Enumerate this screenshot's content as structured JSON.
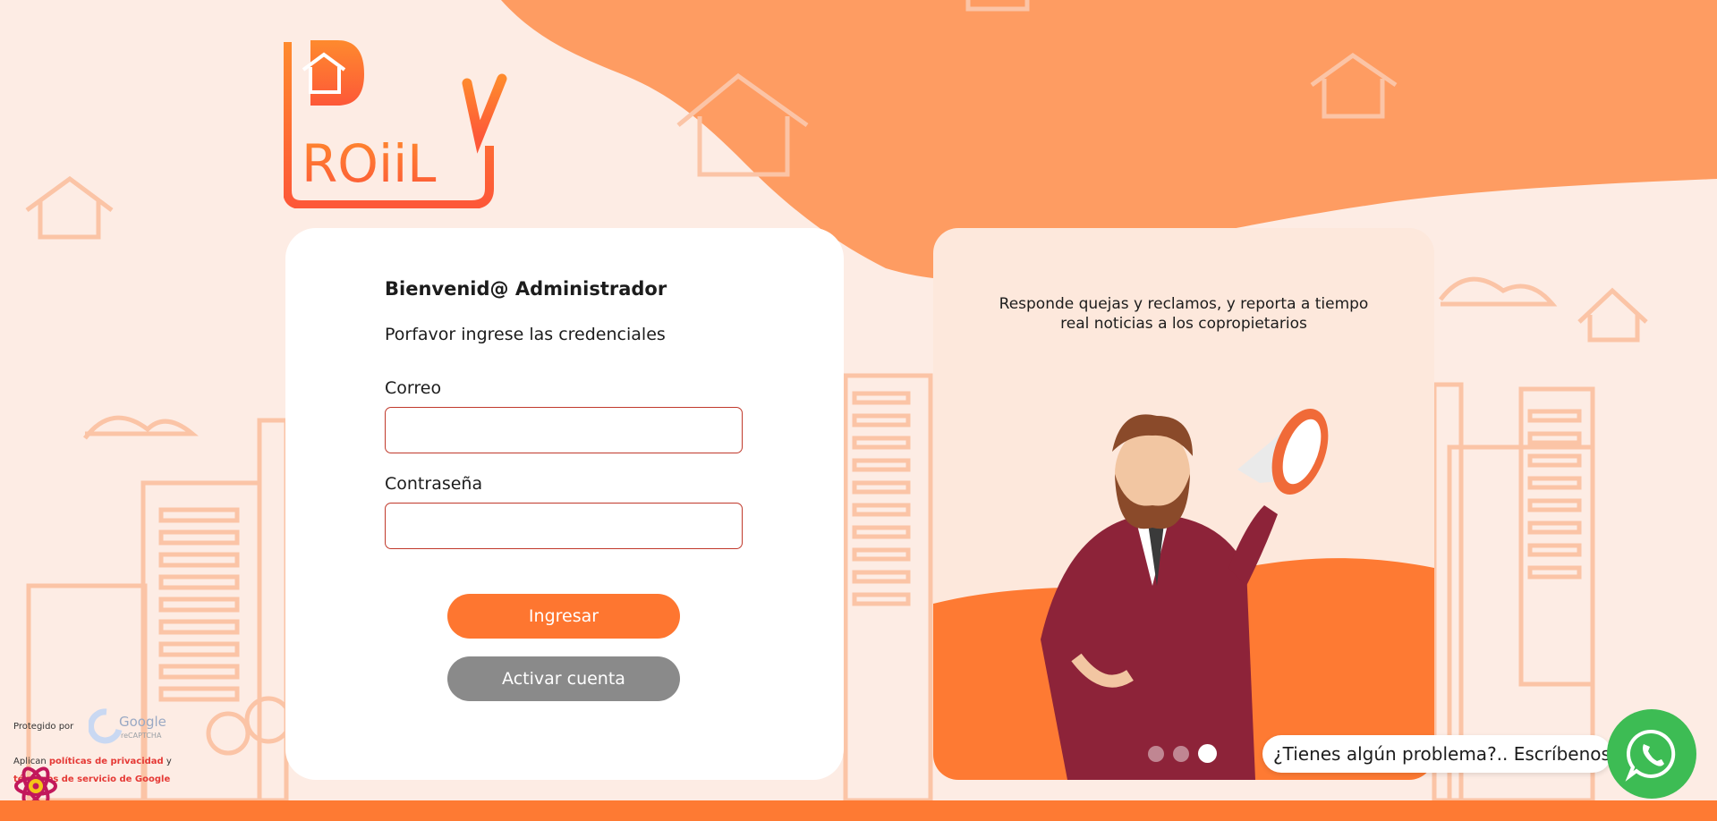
{
  "brand": {
    "logo_text": "ROiiL",
    "accent_color": "#fe7630",
    "orange_light": "#fe9c62"
  },
  "login": {
    "welcome": "Bienvenid@ Administrador",
    "subtitle": "Porfavor ingrese las credenciales",
    "email_label": "Correo",
    "email_value": "",
    "password_label": "Contraseña",
    "password_value": "",
    "submit_label": "Ingresar",
    "activate_label": "Activar cuenta"
  },
  "promo": {
    "text": "Responde quejas y reclamos, y reporta a tiempo real noticias a los copropietarios",
    "slides": 3,
    "active_slide": 3
  },
  "support": {
    "chat_text": "¿Tienes algún problema?.. Escríbenos!",
    "whatsapp_icon": "whatsapp-icon",
    "whatsapp_color": "#3dbc54"
  },
  "recaptcha": {
    "protected_by": "Protegido por",
    "logo_word": "Google",
    "logo_sub": "reCAPTCHA",
    "prefix": "Aplican ",
    "privacy": "políticas de privacidad",
    "connector": " y ",
    "terms": "términos de servicio de Google"
  }
}
